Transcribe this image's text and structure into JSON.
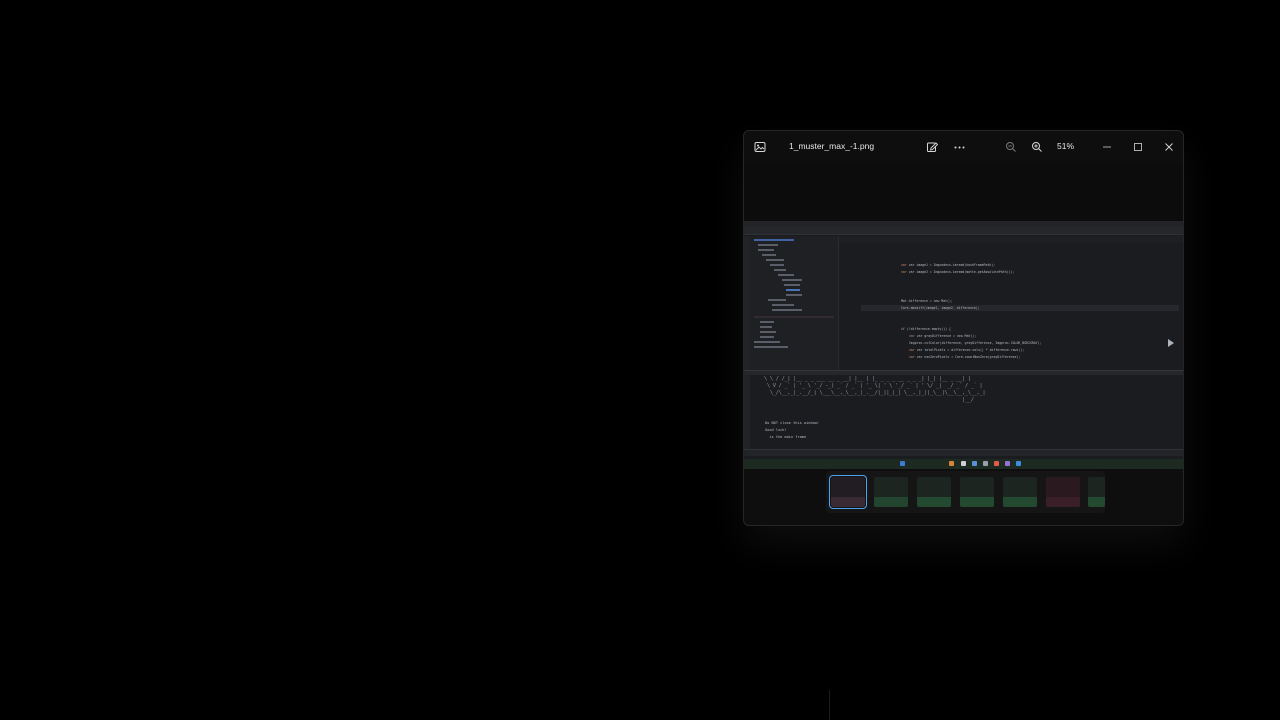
{
  "viewer": {
    "file_name": "1_muster_max_-1.png",
    "zoom_level": "51%",
    "icons": {
      "app": "photos-app-icon",
      "edit": "edit-image-icon",
      "more": "more-options-icon",
      "zoom_out": "zoom-out-icon",
      "zoom_in": "zoom-in-icon",
      "minimize": "minimize-icon",
      "maximize": "maximize-icon",
      "close": "close-icon"
    },
    "colors": {
      "background": "#000000",
      "window": "#0e0e0e",
      "selection_accent": "#4aa3f0"
    }
  },
  "shown_image": {
    "code_lines": [
      "var image1 = Imgcodecs.imread(hashFramePath);",
      "var image2 = Imgcodecs.imread(matte.getAbsolutePath());",
      "Mat difference = new Mat();",
      "Core.absdiff(image1, image2, difference);",
      "if (!difference.empty()) {",
      "var grayDifference = new Mat();",
      "Imgproc.cvtColor(difference, grayDifference, Imgproc.COLOR_BGR2GRAY);",
      "var totalPixels = difference.cols() * difference.rows();",
      "var nonZeroPixels = Core.countNonZero(grayDifference);"
    ],
    "ascii_lines": [
      "\\ \\ / /_| |__ _ _ ___ __ _ __| |__ | |_ _ _ _ __ _ _ _| |_| |__ _ __| |",
      " \\ V / _` | '_ \\ '_/ -_) _` / _` | '_ \\| ' \\ '_/ _` | ' \\/ _|  _/ _` / _` |",
      "  \\_/\\__,_|_.__/_| \\___\\__,_\\__,_|_.__/|_||_|_| \\__,_|_||_\\__|\\__\\__,_\\__,_|",
      "                                                                    |__/"
    ],
    "console_lines": [
      "Do NOT close this window!",
      "Good luck!",
      "  is the main frame"
    ]
  },
  "filmstrip": {
    "count": 7,
    "selected_index": 0
  }
}
